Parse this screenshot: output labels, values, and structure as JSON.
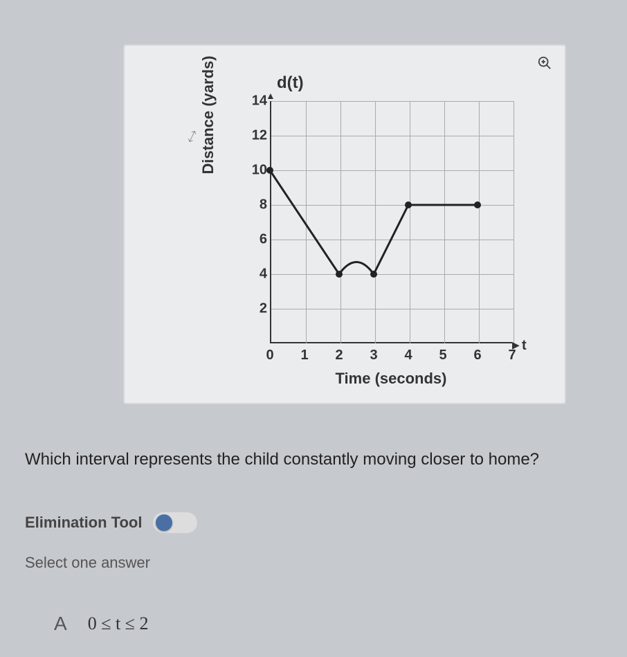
{
  "chart_data": {
    "type": "line",
    "title": "d(t)",
    "xlabel": "Time (seconds)",
    "ylabel": "Distance (yards)",
    "x_axis_variable": "t",
    "x_ticks": [
      0,
      1,
      2,
      3,
      4,
      5,
      6,
      7
    ],
    "y_ticks": [
      2,
      4,
      6,
      8,
      10,
      12,
      14
    ],
    "xlim": [
      0,
      7
    ],
    "ylim": [
      0,
      14
    ],
    "series": [
      {
        "name": "d(t)",
        "points": [
          {
            "t": 0,
            "d": 10
          },
          {
            "t": 2,
            "d": 4
          },
          {
            "t": 2.5,
            "d": 5
          },
          {
            "t": 3,
            "d": 4
          },
          {
            "t": 4,
            "d": 8
          },
          {
            "t": 6,
            "d": 8
          }
        ],
        "marker_points": [
          {
            "t": 0,
            "d": 10
          },
          {
            "t": 2,
            "d": 4
          },
          {
            "t": 3,
            "d": 4
          },
          {
            "t": 4,
            "d": 8
          },
          {
            "t": 6,
            "d": 8
          }
        ]
      }
    ]
  },
  "question": "Which interval represents the child constantly moving closer to home?",
  "elimination_tool": {
    "label": "Elimination Tool",
    "enabled": false
  },
  "select_prompt": "Select one answer",
  "answers": {
    "A": {
      "letter": "A",
      "text": "0 ≤ t ≤ 2"
    }
  },
  "icons": {
    "zoom": "zoom-in-icon",
    "expand": "expand-icon"
  }
}
